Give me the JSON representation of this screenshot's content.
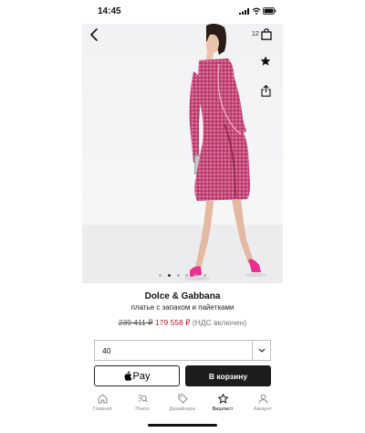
{
  "status_bar": {
    "time": "14:45"
  },
  "header": {
    "bag_count": "12"
  },
  "gallery": {
    "total_images": 6,
    "active_index": 1
  },
  "product": {
    "brand": "Dolce & Gabbana",
    "subtitle": "платье с запахом и пайетками",
    "old_price": "239 411 ₽",
    "new_price": "179 558 ₽",
    "vat_note": "(НДС включен)"
  },
  "size_select": {
    "value": "40"
  },
  "actions": {
    "apple_pay_label": "Pay",
    "add_to_cart_label": "В корзину"
  },
  "tabbar": {
    "items": [
      {
        "label": "Главная",
        "icon": "home-icon"
      },
      {
        "label": "Поиск",
        "icon": "search-icon"
      },
      {
        "label": "Дизайнеры",
        "icon": "tag-icon"
      },
      {
        "label": "Вишлист",
        "icon": "star-icon"
      },
      {
        "label": "Аккаунт",
        "icon": "user-icon"
      }
    ],
    "active_index": 3
  },
  "colors": {
    "price_sale": "#b41f2a",
    "button_dark": "#1c1c1c",
    "dress_pink": "#c7477a"
  }
}
